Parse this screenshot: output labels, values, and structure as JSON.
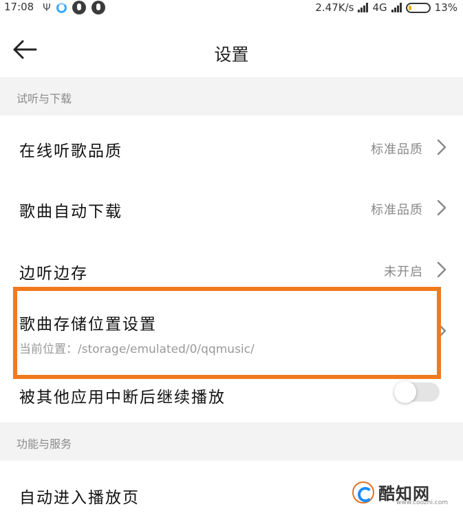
{
  "status_bar": {
    "time": "17:08",
    "network_speed": "2.47K/s",
    "network_type": "4G",
    "battery_percent": "13%",
    "icons": [
      "usb-icon",
      "sync-ring-icon",
      "app-notification-icon",
      "app-notification-icon",
      "signal-icon",
      "battery-icon"
    ]
  },
  "header": {
    "title": "设置",
    "back_icon": "arrow-left-icon"
  },
  "sections": [
    {
      "header": "试听与下载",
      "rows": [
        {
          "label": "在线听歌品质",
          "value": "标准品质",
          "chevron": true
        },
        {
          "label": "歌曲自动下载",
          "value": "标准品质",
          "chevron": true
        },
        {
          "label": "边听边存",
          "value": "未开启",
          "chevron": true
        },
        {
          "label": "歌曲存储位置设置",
          "subtitle": "当前位置：/storage/emulated/0/qqmusic/",
          "chevron": true,
          "highlighted": true,
          "highlight_color": "#f07a1e"
        },
        {
          "label": "被其他应用中断后继续播放",
          "toggle": false
        }
      ]
    },
    {
      "header": "功能与服务",
      "rows": [
        {
          "label": "自动进入播放页"
        }
      ]
    }
  ],
  "watermark": {
    "text": "酷知网",
    "url": "www.coozhi.com"
  },
  "colors": {
    "highlight": "#f07a1e",
    "section_bg": "#f3f3f3",
    "secondary_text": "#888888"
  }
}
